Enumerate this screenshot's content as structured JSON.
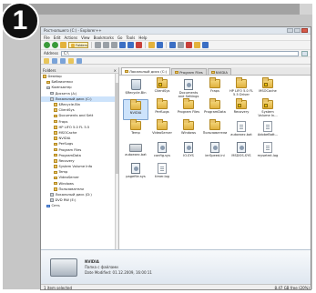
{
  "badge": "1",
  "window": {
    "title": "Ростнапшего (C:) - Explorer++"
  },
  "menu": [
    "File",
    "Edit",
    "Actions",
    "View",
    "Bookmarks",
    "Go",
    "Tools",
    "Help"
  ],
  "toolbar": {
    "folders_label": "Folders"
  },
  "address": {
    "label": "Address",
    "value": "C:\\"
  },
  "tree": {
    "header": "Folders",
    "items": [
      {
        "label": "Desktop",
        "indent": 0,
        "type": "folder"
      },
      {
        "label": "Библиотеки",
        "indent": 1,
        "type": "folder"
      },
      {
        "label": "Компьютер",
        "indent": 1,
        "type": "drive"
      },
      {
        "label": "Дискета (A:)",
        "indent": 2,
        "type": "drive"
      },
      {
        "label": "Локальный диск (C:)",
        "indent": 2,
        "type": "drive",
        "selected": true
      },
      {
        "label": "$Recycle.Bin",
        "indent": 3,
        "type": "folder"
      },
      {
        "label": "ClientSys",
        "indent": 3,
        "type": "folder"
      },
      {
        "label": "Documents and Sett",
        "indent": 3,
        "type": "folder"
      },
      {
        "label": "Fraps",
        "indent": 3,
        "type": "folder"
      },
      {
        "label": "HP LIFO 5.0 FL 5.5",
        "indent": 3,
        "type": "folder"
      },
      {
        "label": "MSOCache",
        "indent": 3,
        "type": "folder"
      },
      {
        "label": "NVIDIA",
        "indent": 3,
        "type": "folder"
      },
      {
        "label": "PerfLogs",
        "indent": 3,
        "type": "folder"
      },
      {
        "label": "Program Files",
        "indent": 3,
        "type": "folder"
      },
      {
        "label": "ProgramData",
        "indent": 3,
        "type": "folder"
      },
      {
        "label": "Recovery",
        "indent": 3,
        "type": "folder"
      },
      {
        "label": "System Volume Info",
        "indent": 3,
        "type": "folder"
      },
      {
        "label": "Temp",
        "indent": 3,
        "type": "folder"
      },
      {
        "label": "VideoServer",
        "indent": 3,
        "type": "folder"
      },
      {
        "label": "Windows",
        "indent": 3,
        "type": "folder"
      },
      {
        "label": "Пользователи",
        "indent": 3,
        "type": "folder"
      },
      {
        "label": "Локальный диск (D:)",
        "indent": 2,
        "type": "drive"
      },
      {
        "label": "DVD RW (E:)",
        "indent": 2,
        "type": "drive"
      },
      {
        "label": "Сеть",
        "indent": 1,
        "type": "net"
      }
    ]
  },
  "tabs": [
    {
      "label": "Локальный диск (C:)",
      "active": true
    },
    {
      "label": "Program Files",
      "active": false
    },
    {
      "label": "NVIDIA",
      "active": false
    }
  ],
  "files": [
    {
      "label": "$Recycle.Bin",
      "icon": "bin"
    },
    {
      "label": "ClientSys",
      "icon": "folder-locked"
    },
    {
      "label": "Documents and Settings",
      "icon": "folder-sys"
    },
    {
      "label": "Fraps",
      "icon": "folder"
    },
    {
      "label": "HP LIFO 5.0 FL 5.5 Driver",
      "icon": "folder"
    },
    {
      "label": "MSOCache",
      "icon": "folder-locked"
    },
    {
      "label": "",
      "icon": "none"
    },
    {
      "label": "NVIDIA",
      "icon": "folder",
      "selected": true
    },
    {
      "label": "PerfLogs",
      "icon": "folder"
    },
    {
      "label": "Program Files",
      "icon": "folder"
    },
    {
      "label": "ProgramData",
      "icon": "folder"
    },
    {
      "label": "Recovery",
      "icon": "folder-locked"
    },
    {
      "label": "System Volume In...",
      "icon": "folder-locked"
    },
    {
      "label": "",
      "icon": "none"
    },
    {
      "label": "Temp",
      "icon": "folder"
    },
    {
      "label": "VideoServer",
      "icon": "folder"
    },
    {
      "label": "Windows",
      "icon": "folder"
    },
    {
      "label": "Пользователи",
      "icon": "folder"
    },
    {
      "label": "autoexec.bat",
      "icon": "file"
    },
    {
      "label": "AdobeBatt...",
      "icon": "file"
    },
    {
      "label": "",
      "icon": "none"
    },
    {
      "label": "autoexec.bat",
      "icon": "drive"
    },
    {
      "label": "config.sys",
      "icon": "sys"
    },
    {
      "label": "IO.SYS",
      "icon": "sys"
    },
    {
      "label": "ierSpeed.ini",
      "icon": "sys"
    },
    {
      "label": "MSDOS.SYS",
      "icon": "sys"
    },
    {
      "label": "mysetmt.log",
      "icon": "file"
    },
    {
      "label": "",
      "icon": "none"
    },
    {
      "label": "pagefile.sys",
      "icon": "sys"
    },
    {
      "label": "timer.log",
      "icon": "file"
    }
  ],
  "details": {
    "name": "NVIDIA",
    "type": "Папка с файлами",
    "date": "Date Modified: 01.12.2009, 16:00:11"
  },
  "status": {
    "left": "1 item selected",
    "right": "8.47 GB free (20%)"
  }
}
